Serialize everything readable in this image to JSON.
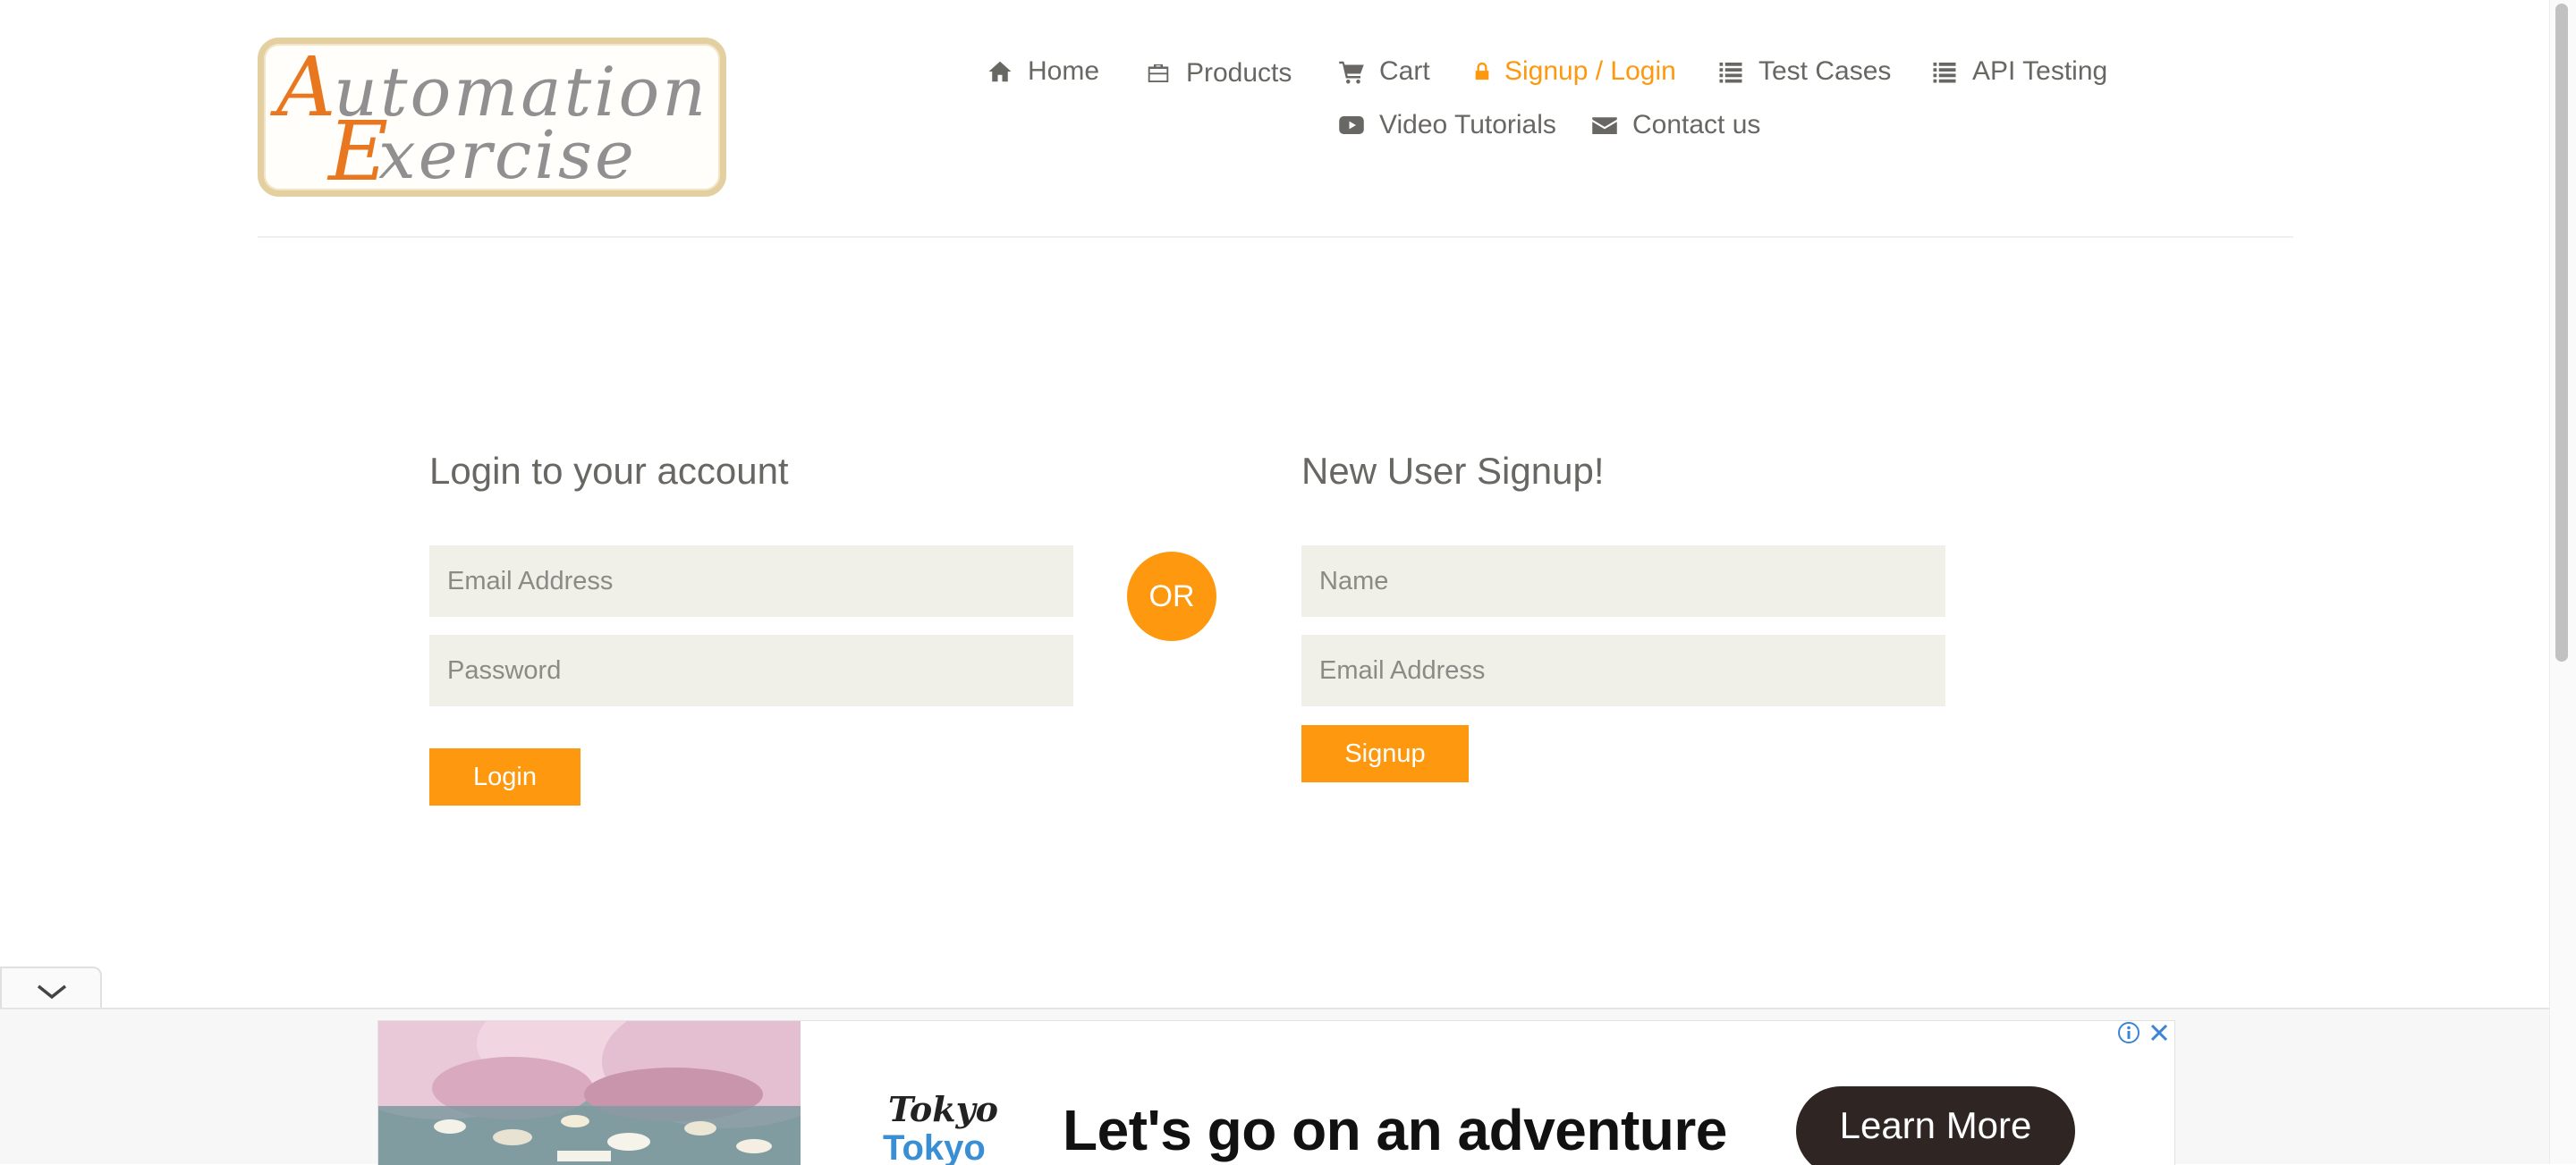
{
  "logo": {
    "line1": "Automation",
    "line2": "Exercise"
  },
  "nav": {
    "items": [
      {
        "label": "Home",
        "icon": "home-icon"
      },
      {
        "label": "Products",
        "icon": "briefcase-icon"
      },
      {
        "label": "Cart",
        "icon": "cart-icon"
      },
      {
        "label": "Signup / Login",
        "icon": "lock-icon",
        "active": true
      },
      {
        "label": "Test Cases",
        "icon": "list-icon"
      },
      {
        "label": "API Testing",
        "icon": "list-icon"
      },
      {
        "label": "Video Tutorials",
        "icon": "youtube-play-icon"
      },
      {
        "label": "Contact us",
        "icon": "envelope-icon"
      }
    ]
  },
  "login": {
    "title": "Login to your account",
    "email_placeholder": "Email Address",
    "password_placeholder": "Password",
    "button": "Login"
  },
  "divider_text": "OR",
  "signup": {
    "title": "New User Signup!",
    "name_placeholder": "Name",
    "email_placeholder": "Email Address",
    "button": "Signup"
  },
  "ad": {
    "brand_top": "Tokyo",
    "brand_bottom": "Tokyo",
    "headline": "Let's go on an adventure",
    "cta": "Learn More"
  },
  "colors": {
    "accent": "#FE980F",
    "text": "#696763",
    "input_bg": "#F0F0E9",
    "logo_orange": "#E8771F",
    "logo_gray": "#909090"
  }
}
